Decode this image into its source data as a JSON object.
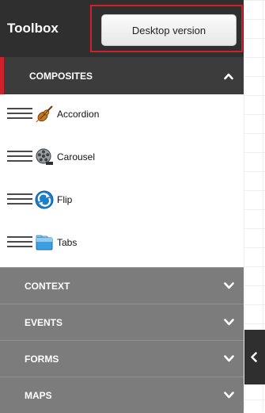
{
  "toolbar": {
    "title": "Toolbox",
    "desktop_button": "Desktop version"
  },
  "composites": {
    "label": "COMPOSITES",
    "items": [
      {
        "label": "Accordion",
        "icon": "violin-icon"
      },
      {
        "label": "Carousel",
        "icon": "film-reel-icon"
      },
      {
        "label": "Flip",
        "icon": "flip-arrows-icon"
      },
      {
        "label": "Tabs",
        "icon": "folder-tabs-icon"
      }
    ]
  },
  "categories": [
    {
      "label": "CONTEXT"
    },
    {
      "label": "EVENTS"
    },
    {
      "label": "FORMS"
    },
    {
      "label": "MAPS"
    }
  ],
  "colors": {
    "toolbar_bg": "#2f2f2f",
    "accent": "#d0202a",
    "category_bg": "#7c7c7c"
  }
}
